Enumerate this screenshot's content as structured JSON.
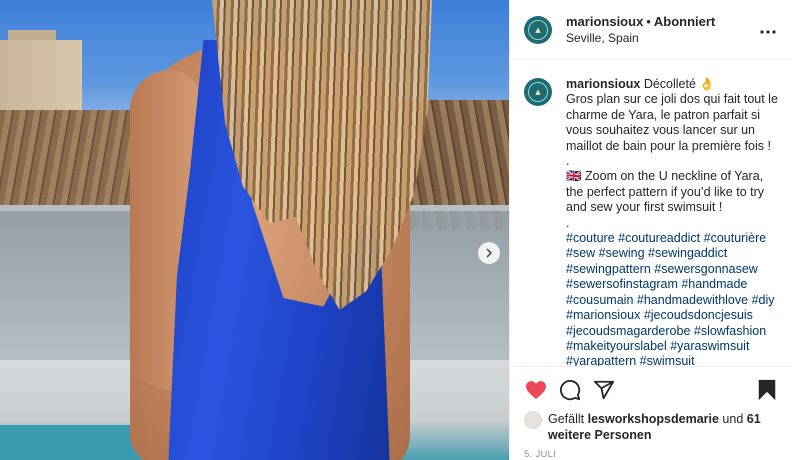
{
  "post": {
    "username": "marionsioux",
    "follow_separator": "•",
    "follow_status": "Abonniert",
    "location": "Seville, Spain",
    "more_icon": "more-horizontal-icon"
  },
  "caption": {
    "username": "marionsioux",
    "line_fr_title": "Décolleté 👌",
    "line_fr_body": "Gros plan sur ce joli dos qui fait tout le charme de Yara, le patron parfait si vous souhaitez vous lancer sur un maillot de bain pour la première fois !",
    "separator1": ".",
    "line_en": "🇬🇧 Zoom on the U neckline of Yara, the perfect pattern if you’d like to try and sew your first swimsuit !",
    "separator2": ".",
    "hashtags": [
      "#couture",
      "#coutureaddict",
      "#couturière",
      "#sew",
      "#sewing",
      "#sewingaddict",
      "#sewingpattern",
      "#sewersgonnasew",
      "#sewersofinstagram",
      "#handmade",
      "#cousumain",
      "#handmadewithlove",
      "#diy",
      "#marionsioux",
      "#jecoudsdoncjesuis",
      "#jecoudsmagarderobe",
      "#slowfashion",
      "#makeityourslabel",
      "#yaraswimsuit",
      "#yarapattern",
      "#swimsuit"
    ]
  },
  "actions": {
    "like_icon": "heart-icon",
    "comment_icon": "comment-icon",
    "share_icon": "paper-plane-icon",
    "save_icon": "bookmark-icon",
    "like_color": "#ed4956"
  },
  "likes": {
    "prefix": "Gefällt",
    "user": "lesworkshopsdemarie",
    "conjunction": "und",
    "others": "61 weitere Personen"
  },
  "date": "5. JULI"
}
